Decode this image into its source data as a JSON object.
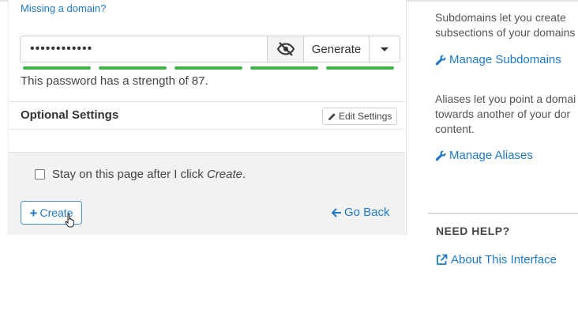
{
  "form": {
    "missing_domain_link": "Missing a domain?",
    "password_value": "••••••••••••",
    "generate_label": "Generate",
    "strength_segments": 5,
    "strength_text": "This password has a strength of 87.",
    "optional_settings_title": "Optional Settings",
    "edit_settings_label": "Edit Settings",
    "stay_label_prefix": "Stay on this page after I click ",
    "stay_label_emph": "Create",
    "stay_label_suffix": ".",
    "create_label": "Create",
    "go_back_label": "Go Back"
  },
  "sidebar": {
    "subdomains_line1": "Subdomains let you create",
    "subdomains_line2": "subsections of your domains",
    "manage_subdomains": "Manage Subdomains",
    "aliases_line1": "Aliases let you point a domai",
    "aliases_line2": "towards another of your dor",
    "aliases_line3": "content.",
    "manage_aliases": "Manage Aliases",
    "need_help_title": "NEED HELP?",
    "about_link": "About This Interface"
  },
  "colors": {
    "link": "#1f78c6",
    "strength_bar": "#3bb54a",
    "footer_bg": "#f2f2f2"
  }
}
